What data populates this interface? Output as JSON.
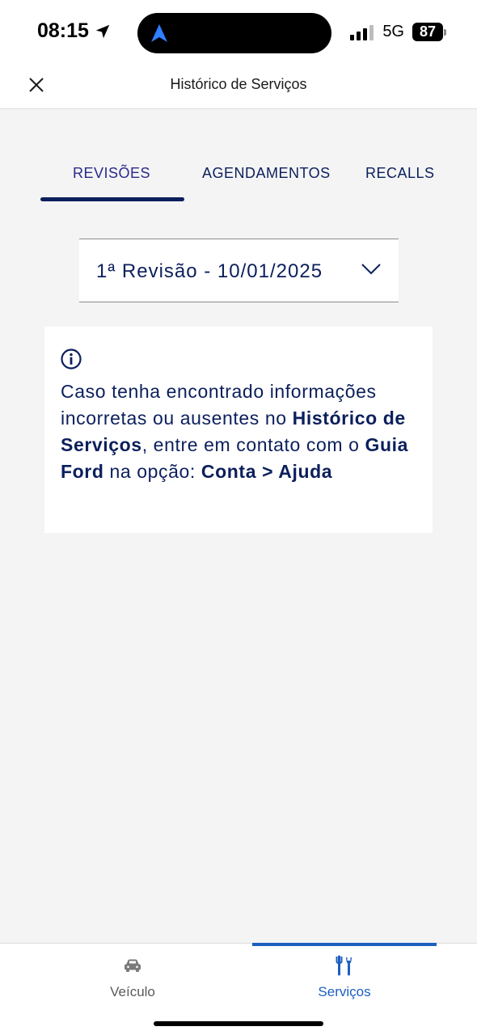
{
  "status_bar": {
    "time": "08:15",
    "network": "5G",
    "battery": "87"
  },
  "header": {
    "title": "Histórico de Serviços",
    "close_icon": "close-icon"
  },
  "tabs": [
    {
      "label": "REVISÕES",
      "active": true
    },
    {
      "label": "AGENDAMENTOS",
      "active": false
    },
    {
      "label": "RECALLS",
      "active": false
    }
  ],
  "revision_select": {
    "value": "1ª Revisão - 10/01/2025",
    "icon": "chevron-down-icon"
  },
  "info_card": {
    "icon": "info-icon",
    "text_part1": "Caso tenha encontrado informações incorretas ou ausentes no ",
    "bold1": "Histórico de Serviços",
    "text_part2": ", entre em contato com o ",
    "bold2": "Guia Ford",
    "text_part3": " na opção: ",
    "bold3": "Conta > Ajuda"
  },
  "bottom_nav": [
    {
      "label": "Veículo",
      "icon": "car-icon",
      "active": false
    },
    {
      "label": "Serviços",
      "icon": "tools-icon",
      "active": true
    }
  ],
  "colors": {
    "brand_navy": "#0b1f5c",
    "active_blue": "#1d5fbf",
    "background": "#f4f4f4"
  }
}
